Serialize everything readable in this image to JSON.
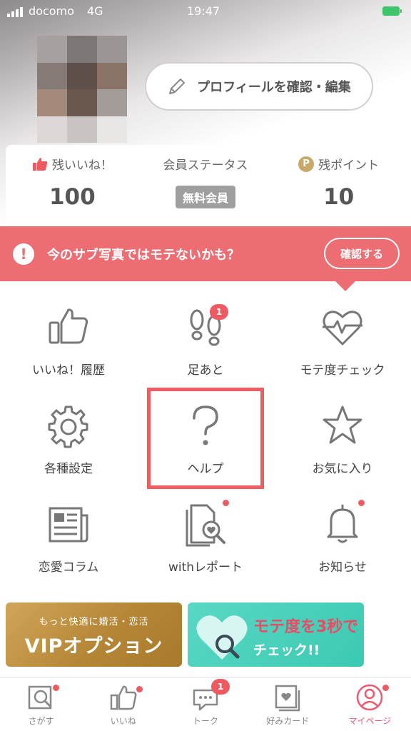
{
  "status_bar": {
    "carrier": "docomo",
    "network": "4G",
    "time": "19:47"
  },
  "profile": {
    "edit_button_label": "プロフィールを確認・編集"
  },
  "stats": {
    "likes_label": "残いいね！",
    "likes_value": "100",
    "status_label": "会員ステータス",
    "status_value": "無料会員",
    "points_icon": "P",
    "points_label": "残ポイント",
    "points_value": "10"
  },
  "alert": {
    "message": "今のサブ写真ではモテないかも？",
    "button_label": "確認する"
  },
  "menu": {
    "like_history": "いいね！履歴",
    "footprints": "足あと",
    "footprints_badge": "1",
    "mote_check": "モテ度チェック",
    "settings": "各種設定",
    "help": "ヘルプ",
    "favorites": "お気に入り",
    "love_column": "恋愛コラム",
    "with_report": "withレポート",
    "notifications": "お知らせ"
  },
  "banners": {
    "vip_sub": "もっと快適に婚活・恋活",
    "vip_main": "VIPオプション",
    "mote_line1": "モテ度を3秒で",
    "mote_line2": "チェック!!"
  },
  "tabs": {
    "search": "さがす",
    "likes": "いいね",
    "talk": "トーク",
    "talk_badge": "1",
    "fav_cards": "好みカード",
    "mypage": "マイページ"
  },
  "colors": {
    "accent": "#ec6e73",
    "highlight": "#f05c63",
    "gold": "#b68637",
    "teal": "#3bc9b2"
  }
}
